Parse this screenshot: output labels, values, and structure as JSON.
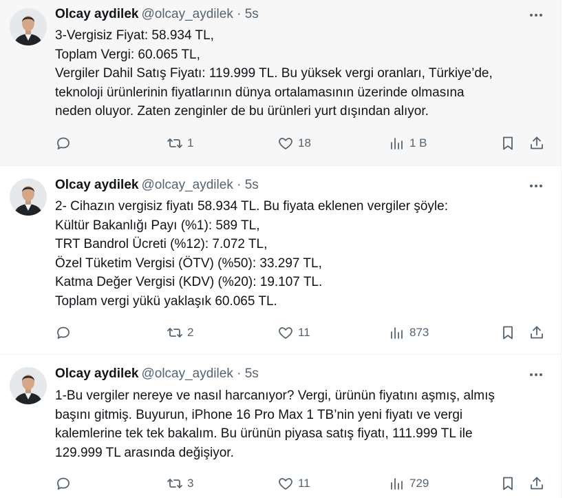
{
  "tweets": [
    {
      "author_name": "Olcay aydilek",
      "handle_time": "@olcay_aydilek · 5s",
      "lines": [
        "3-Vergisiz Fiyat: 58.934 TL,",
        "Toplam Vergi: 60.065 TL,",
        "Vergiler Dahil Satış Fiyatı: 119.999 TL. Bu yüksek vergi oranları, Türkiye’de,",
        "teknoloji ürünlerinin fiyatlarının dünya ortalamasının üzerinde olmasına",
        "neden oluyor. Zaten zenginler de bu ürünleri yurt dışından alıyor."
      ],
      "reply_count": "",
      "retweet_count": "1",
      "like_count": "18",
      "view_count": "1 B"
    },
    {
      "author_name": "Olcay aydilek",
      "handle_time": "@olcay_aydilek · 5s",
      "lines": [
        "2- Cihazın vergisiz fiyatı 58.934 TL. Bu fiyata eklenen vergiler şöyle:",
        "Kültür Bakanlığı Payı (%1): 589 TL,",
        "TRT Bandrol Ücreti (%12): 7.072 TL,",
        "Özel Tüketim Vergisi (ÖTV) (%50): 33.297 TL,",
        "Katma Değer Vergisi (KDV) (%20): 19.107 TL.",
        "Toplam vergi yükü yaklaşık 60.065 TL."
      ],
      "reply_count": "",
      "retweet_count": "2",
      "like_count": "11",
      "view_count": "873"
    },
    {
      "author_name": "Olcay aydilek",
      "handle_time": "@olcay_aydilek · 5s",
      "lines": [
        "1-Bu vergiler nereye ve nasıl harcanıyor? Vergi, ürünün fiyatını aşmış, almış",
        "başını gitmiş. Buyurun, iPhone 16 Pro Max 1 TB’nin yeni fiyatı ve vergi",
        "kalemlerine tek tek  bakalım. Bu ürünün piyasa satış fiyatı, 111.999 TL ile",
        "129.999 TL arasında değişiyor."
      ],
      "reply_count": "",
      "retweet_count": "3",
      "like_count": "11",
      "view_count": "729"
    }
  ]
}
